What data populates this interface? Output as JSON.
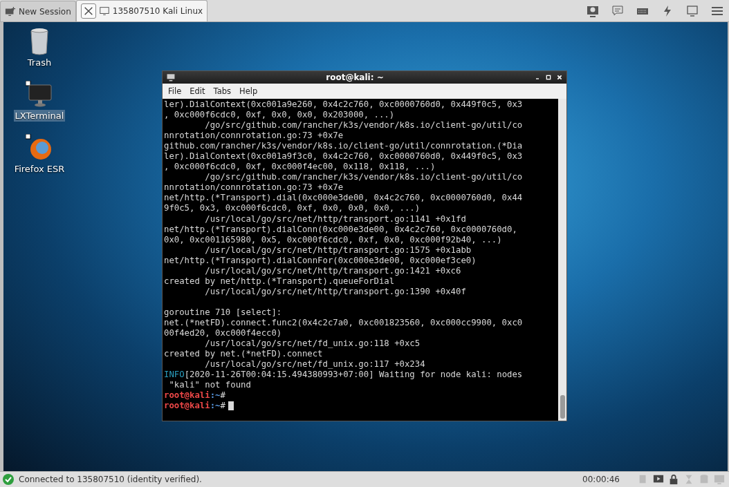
{
  "session_tabs": [
    {
      "label": "New Session",
      "selected": false
    },
    {
      "label": "135807510 Kali Linux",
      "selected": true
    }
  ],
  "desktop_icons": [
    {
      "kind": "trash",
      "label": "Trash",
      "selected": false
    },
    {
      "kind": "monitor",
      "label": "LXTerminal",
      "selected": true
    },
    {
      "kind": "browser",
      "label": "Firefox ESR",
      "selected": false
    }
  ],
  "terminal": {
    "title": "root@kali: ~",
    "menu": [
      "File",
      "Edit",
      "Tabs",
      "Help"
    ],
    "lines": [
      {
        "kind": "plain",
        "text": "ler).DialContext(0xc001a9e260, 0x4c2c760, 0xc0000760d0, 0x449f0c5, 0x3"
      },
      {
        "kind": "plain",
        "text": ", 0xc000f6cdc0, 0xf, 0x0, 0x0, 0x203000, ...)"
      },
      {
        "kind": "plain",
        "text": "        /go/src/github.com/rancher/k3s/vendor/k8s.io/client-go/util/co"
      },
      {
        "kind": "plain",
        "text": "nnrotation/connrotation.go:73 +0x7e"
      },
      {
        "kind": "plain",
        "text": "github.com/rancher/k3s/vendor/k8s.io/client-go/util/connrotation.(*Dia"
      },
      {
        "kind": "plain",
        "text": "ler).DialContext(0xc001a9f3c0, 0x4c2c760, 0xc0000760d0, 0x449f0c5, 0x3"
      },
      {
        "kind": "plain",
        "text": ", 0xc000f6cdc0, 0xf, 0xc000f4ec00, 0x118, 0x118, ...)"
      },
      {
        "kind": "plain",
        "text": "        /go/src/github.com/rancher/k3s/vendor/k8s.io/client-go/util/co"
      },
      {
        "kind": "plain",
        "text": "nnrotation/connrotation.go:73 +0x7e"
      },
      {
        "kind": "plain",
        "text": "net/http.(*Transport).dial(0xc000e3de00, 0x4c2c760, 0xc0000760d0, 0x44"
      },
      {
        "kind": "plain",
        "text": "9f0c5, 0x3, 0xc000f6cdc0, 0xf, 0x0, 0x0, 0x0, ...)"
      },
      {
        "kind": "plain",
        "text": "        /usr/local/go/src/net/http/transport.go:1141 +0x1fd"
      },
      {
        "kind": "plain",
        "text": "net/http.(*Transport).dialConn(0xc000e3de00, 0x4c2c760, 0xc0000760d0,"
      },
      {
        "kind": "plain",
        "text": "0x0, 0xc001165980, 0x5, 0xc000f6cdc0, 0xf, 0x0, 0xc000f92b40, ...)"
      },
      {
        "kind": "plain",
        "text": "        /usr/local/go/src/net/http/transport.go:1575 +0x1abb"
      },
      {
        "kind": "plain",
        "text": "net/http.(*Transport).dialConnFor(0xc000e3de00, 0xc000ef3ce0)"
      },
      {
        "kind": "plain",
        "text": "        /usr/local/go/src/net/http/transport.go:1421 +0xc6"
      },
      {
        "kind": "plain",
        "text": "created by net/http.(*Transport).queueForDial"
      },
      {
        "kind": "plain",
        "text": "        /usr/local/go/src/net/http/transport.go:1390 +0x40f"
      },
      {
        "kind": "blank"
      },
      {
        "kind": "plain",
        "text": "goroutine 710 [select]:"
      },
      {
        "kind": "plain",
        "text": "net.(*netFD).connect.func2(0x4c2c7a0, 0xc001823560, 0xc000cc9900, 0xc0"
      },
      {
        "kind": "plain",
        "text": "00f4ed20, 0xc000f4ecc0)"
      },
      {
        "kind": "plain",
        "text": "        /usr/local/go/src/net/fd_unix.go:118 +0xc5"
      },
      {
        "kind": "plain",
        "text": "created by net.(*netFD).connect"
      },
      {
        "kind": "plain",
        "text": "        /usr/local/go/src/net/fd_unix.go:117 +0x234"
      },
      {
        "kind": "info",
        "tag": "INFO",
        "text": "[2020-11-26T00:04:15.494380993+07:00] Waiting for node kali: nodes"
      },
      {
        "kind": "plain",
        "text": " \"kali\" not found"
      },
      {
        "kind": "prompt",
        "user": "root@kali",
        "path": ":~",
        "symbol": "#",
        "cursor": false
      },
      {
        "kind": "prompt",
        "user": "root@kali",
        "path": ":~",
        "symbol": "#",
        "cursor": true
      }
    ]
  },
  "status_bar": {
    "message": "Connected to 135807510 (identity verified).",
    "time": "00:00:46"
  }
}
